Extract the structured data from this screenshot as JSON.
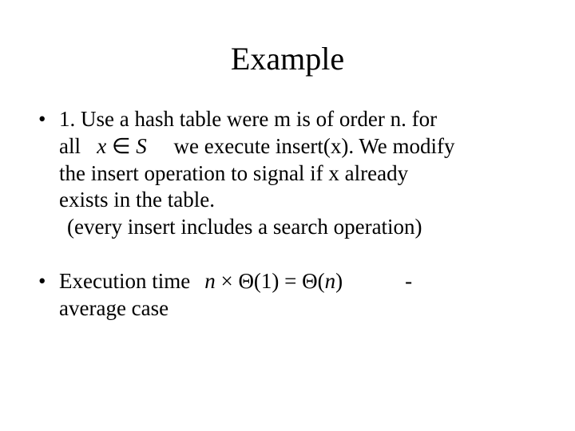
{
  "title": "Example",
  "bullet1": {
    "line1_a": "1. Use a hash table were m is of order n. for",
    "line2_a": "all",
    "math_x": "x",
    "math_in": "∈",
    "math_S": "S",
    "line2_b": "we execute insert(x). We modify",
    "line3": "the insert operation to signal if x already",
    "line4": "exists in the table.",
    "paren": "(every insert includes a search operation)"
  },
  "bullet2": {
    "left1": "Execution time",
    "left2": "average case",
    "math_n": "n",
    "math_times": "×",
    "math_theta1a": "Θ(1)",
    "math_eq": "=",
    "math_theta_n_a": "Θ(",
    "math_theta_n_var": "n",
    "math_theta_n_b": ")",
    "dash": "-"
  }
}
